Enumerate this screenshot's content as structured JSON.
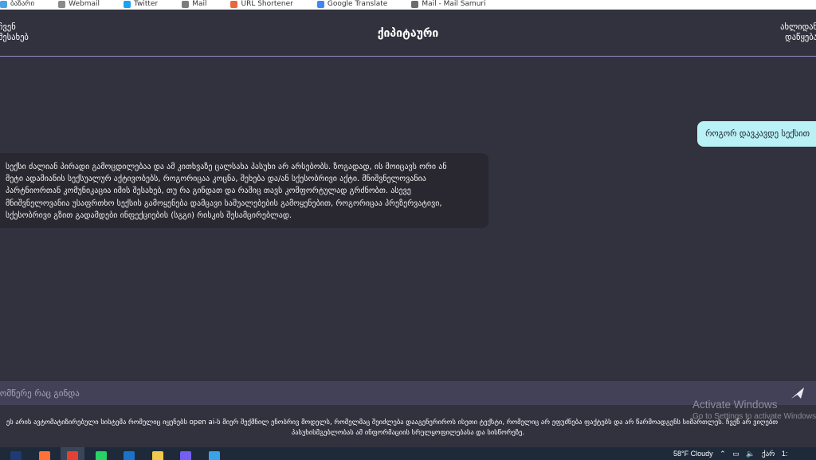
{
  "bookmarks": [
    {
      "label": "ბაზარი",
      "color": "#4aa3df"
    },
    {
      "label": "Webmail",
      "color": "#8a8a8a"
    },
    {
      "label": "Twitter",
      "color": "#1da1f2"
    },
    {
      "label": "Mail",
      "color": "#7c7c7c"
    },
    {
      "label": "URL Shortener",
      "color": "#e8693a"
    },
    {
      "label": "Google Translate",
      "color": "#4285f4"
    },
    {
      "label": "Mail - Mail Samuri",
      "color": "#6b6b6b"
    }
  ],
  "header": {
    "left_line1": "ჩვენ",
    "left_line2": "შესახებ",
    "title": "ქიპიტაური",
    "right_line1": "ახლიდან",
    "right_line2": "დაწყება"
  },
  "chat": {
    "user_message": "როგორ დავკავდე სექსით",
    "bot_lines": [
      "სექსი ძალიან პირადი გამოცდილებაა და ამ კითხვაზე ცალსახა პასუხი არ არსებობს. ზოგადად, ის მოიცავს ორი ან",
      "მეტი ადამიანის სექსუალურ აქტივობებს, როგორიცაა კოცნა, შეხება და/ან სქესობრივი აქტი. მნიშვნელოვანია",
      "პარტნიორთან კომუნიკაცია იმის შესახებ, თუ რა გინდათ და რაშიც თავს კომფორტულად გრძნობთ. ასევე",
      "მნიშვნელოვანია უსაფრთხო სექსის გამოყენება დამცავი საშუალებების გამოყენებით, როგორიცაა პრეზერვატივი,",
      "სქესობრივი გზით გადამდები ინფექციების (სგგი) რისკის შესამცირებლად."
    ]
  },
  "input": {
    "placeholder": "მომწერე რაც გინდა"
  },
  "footer": {
    "line1": "ეს არის ავტომატიზირებული სისტემა რომელიც იყენებს open ai-ს მიერ შექმნილ ენობრივ მოდელს, რომელმაც შეიძლება დააგენერიროს ისეთი ტექსტი, რომელიც არ ეფუძნება ფაქტებს და არ წარმოადგენს სიმართლეს. ჩვენ არ ვიღებთ",
    "line2": "პასუხისმგებლობას ამ ინფორმაციის სრულყოფილებასა და სისწორეზე."
  },
  "watermark": {
    "title": "Activate Windows",
    "subtitle": "Go to Settings to activate Windows."
  },
  "taskbar": {
    "apps": [
      {
        "name": "photoshop-icon",
        "color": "#1f3b73"
      },
      {
        "name": "firefox-icon",
        "color": "#ff7139"
      },
      {
        "name": "chrome-icon",
        "color": "#e44134"
      },
      {
        "name": "whatsapp-icon",
        "color": "#25d366"
      },
      {
        "name": "outlook-icon",
        "color": "#1a73c8"
      },
      {
        "name": "file-explorer-icon",
        "color": "#f2c94c"
      },
      {
        "name": "viber-icon",
        "color": "#7360f2"
      },
      {
        "name": "photos-icon",
        "color": "#3aa3e8"
      }
    ],
    "active_index": 2,
    "weather": "58°F  Cloudy",
    "language": "ქარ",
    "clock": "1:"
  }
}
